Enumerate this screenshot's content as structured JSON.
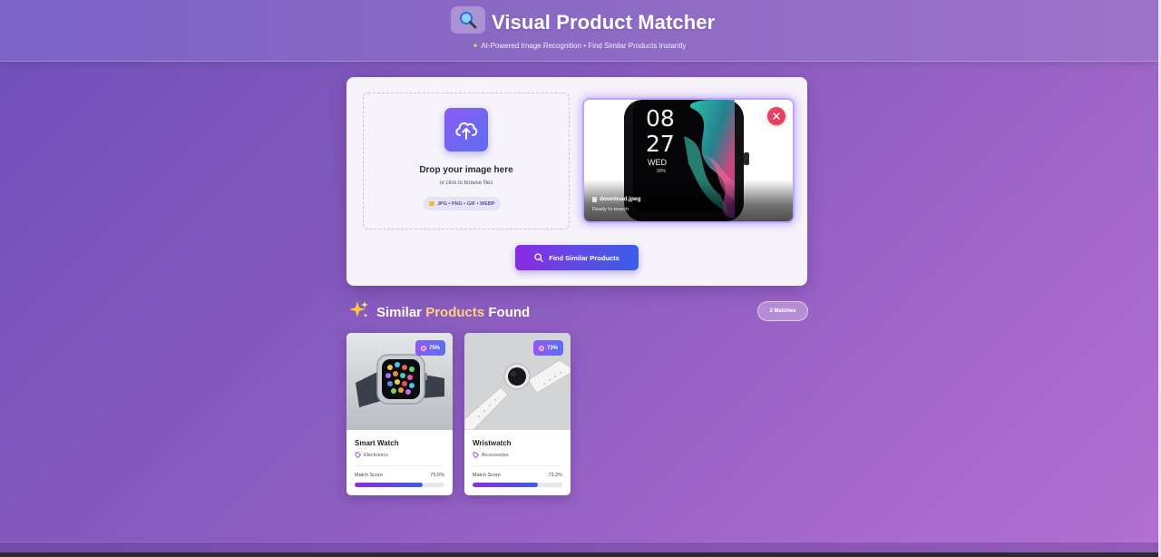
{
  "header": {
    "title": "Visual Product Matcher",
    "subtitle": "AI-Powered Image Recognition • Find Similar Products Instantly",
    "logo_icon": "magnifier-icon"
  },
  "upload": {
    "drop_title": "Drop your image here",
    "drop_subtitle": "or click to browse files",
    "formats": "JPG • PNG • GIF • WEBP",
    "icon": "cloud-upload-icon",
    "preview": {
      "file_name": "download.jpeg",
      "status": "Ready to search",
      "watch_time_hour": "08",
      "watch_time_min": "27",
      "watch_day": "WED",
      "watch_battery": "90%"
    },
    "find_button_label": "Find Similar Products"
  },
  "results": {
    "title_prefix": "Similar ",
    "title_highlight": "Products",
    "title_suffix": " Found",
    "matches_label": "2 Matches",
    "score_label": "Match Score",
    "products": [
      {
        "name": "Smart Watch",
        "category": "Electronics",
        "badge": "75%",
        "score": "75.5%",
        "fill": 0.755
      },
      {
        "name": "Wristwatch",
        "category": "Accessories",
        "badge": "73%",
        "score": "73.2%",
        "fill": 0.732
      }
    ]
  },
  "colors": {
    "accent_start": "#8a2be2",
    "accent_end": "#3b5de7",
    "remove": "#e8415f",
    "highlight": "#ffd27a"
  }
}
